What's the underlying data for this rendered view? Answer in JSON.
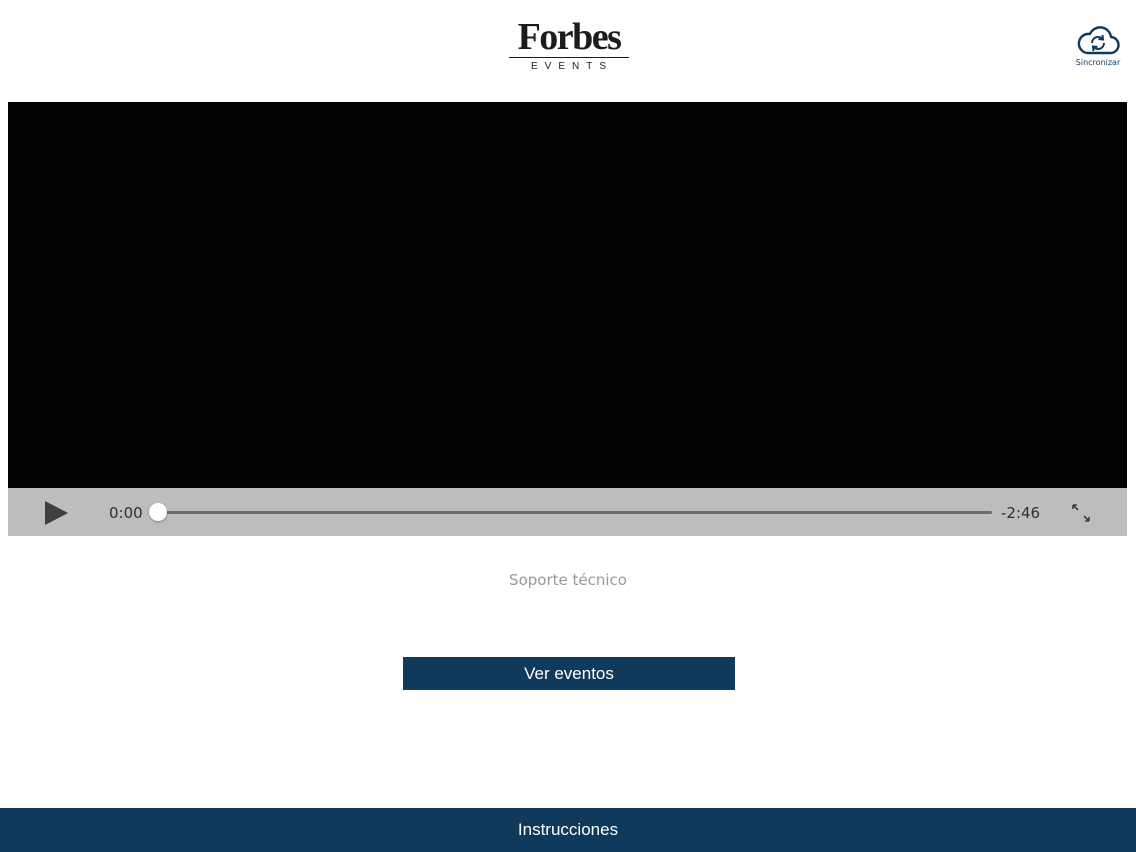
{
  "header": {
    "logo": {
      "word": "Forbes",
      "sub": "EVENTS"
    },
    "sync": {
      "label": "Sincronizar",
      "icon": "cloud-sync-icon"
    }
  },
  "player": {
    "elapsed": "0:00",
    "remaining": "-2:46",
    "progress": 0,
    "icons": {
      "play": "play-icon",
      "fullscreen": "expand-icon"
    }
  },
  "support": {
    "label": "Soporte técnico"
  },
  "events_button": {
    "label": "Ver eventos"
  },
  "footer": {
    "label": "Instrucciones"
  },
  "colors": {
    "brand_navy": "#0f3a5c",
    "video_bg": "#020104",
    "controls_bg": "#bdbdbf",
    "muted_text": "#9a9a9a"
  }
}
